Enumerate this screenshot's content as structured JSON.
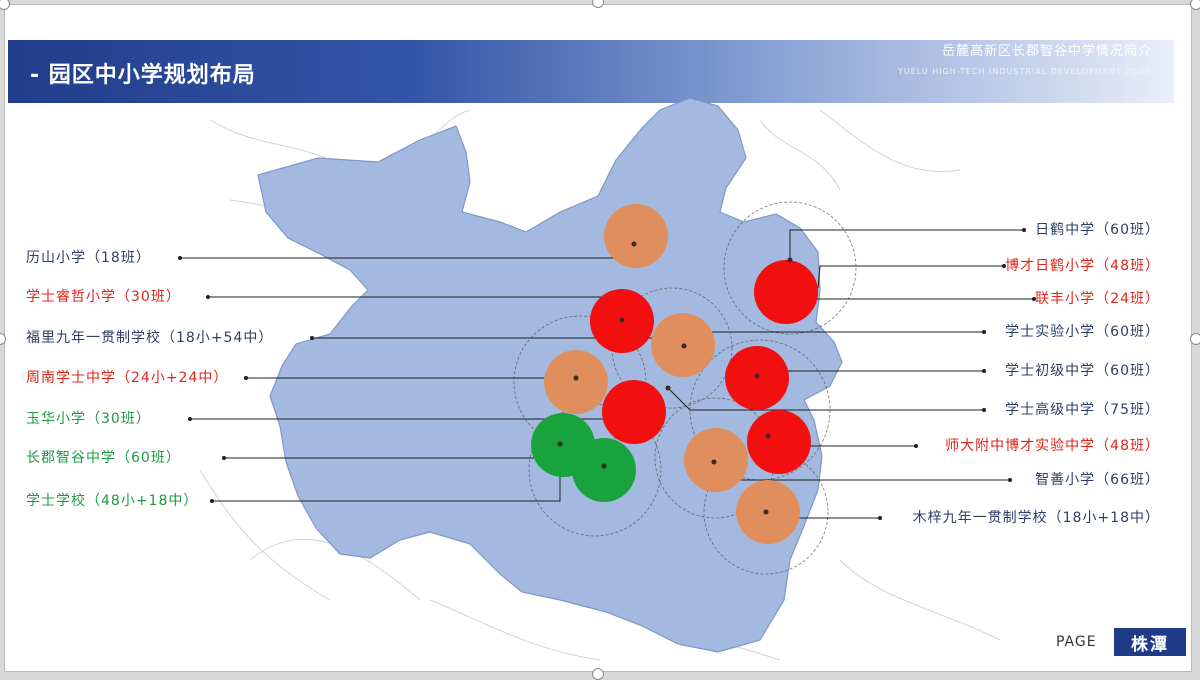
{
  "header": {
    "title": "- 园区中小学规划布局",
    "subtitle_cn": "岳麓高新区长郡智谷中学情况简介",
    "subtitle_en": "YUELU HIGH-TECH INDUSTRIAL DEVELOPMENT ZONE"
  },
  "colors": {
    "map_fill": "#a4b9e0",
    "red": "#f20f0f",
    "orange": "#e08e5e",
    "green": "#19a33c",
    "label_default": "#2d3f67",
    "label_red": "#e0251b",
    "label_green": "#1f9b45"
  },
  "schools_left": [
    {
      "label": "历山小学（18班）",
      "type": "default"
    },
    {
      "label": "学士睿哲小学（30班）",
      "type": "red"
    },
    {
      "label": "福里九年一贯制学校（18小+54中）",
      "type": "default"
    },
    {
      "label": "周南学士中学（24小+24中）",
      "type": "red"
    },
    {
      "label": "玉华小学（30班）",
      "type": "green"
    },
    {
      "label": "长郡智谷中学（60班）",
      "type": "green"
    },
    {
      "label": "学士学校（48小+18中）",
      "type": "green"
    }
  ],
  "schools_right": [
    {
      "label": "日鹤中学（60班）",
      "type": "default"
    },
    {
      "label": "博才日鹤小学（48班）",
      "type": "red"
    },
    {
      "label": "联丰小学（24班）",
      "type": "red"
    },
    {
      "label": "学士实验小学（60班）",
      "type": "default"
    },
    {
      "label": "学士初级中学（60班）",
      "type": "default"
    },
    {
      "label": "学士高级中学（75班）",
      "type": "default"
    },
    {
      "label": "师大附中博才实验中学（48班）",
      "type": "red"
    },
    {
      "label": "智善小学（66班）",
      "type": "default"
    },
    {
      "label": "木梓九年一贯制学校（18小+18中）",
      "type": "default"
    }
  ],
  "footer": {
    "page_word": "PAGE",
    "logo": "株潭"
  }
}
